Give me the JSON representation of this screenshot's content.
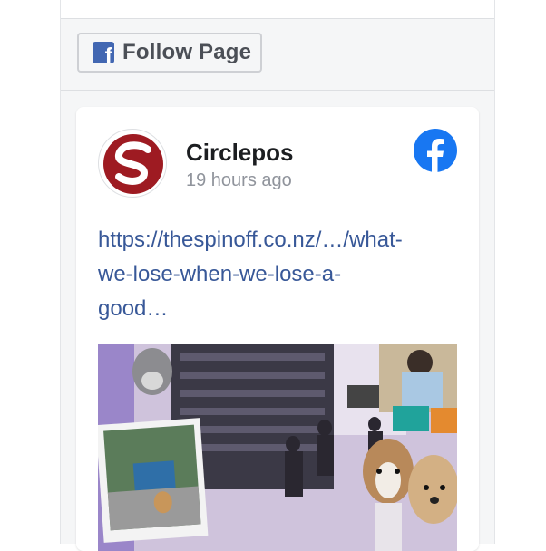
{
  "follow_button": {
    "label": "Follow Page",
    "icon": "facebook-f-icon"
  },
  "post": {
    "page_name": "Circlepos",
    "time": "19 hours ago",
    "link_line_1": "https://thespinoff.co.nz/…/what-",
    "link_line_2": "we-lose-when-we-lose-a-",
    "link_line_3": "good…",
    "image_icon": "bookshop-collage-image"
  },
  "colors": {
    "facebook_blue": "#4267b2",
    "link_blue": "#385898",
    "logo_blue": "#1877f2",
    "brand_red": "#9e1b22"
  }
}
